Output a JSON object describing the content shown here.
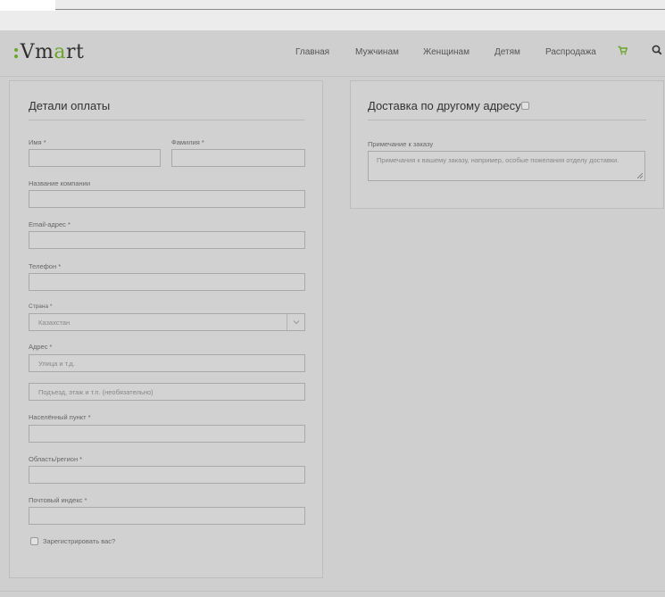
{
  "header": {
    "logo": {
      "prefix": ":",
      "part1": "Vm",
      "accent": "a",
      "part2": "rt"
    },
    "nav": [
      {
        "label": "Главная"
      },
      {
        "label": "Мужчинам"
      },
      {
        "label": "Женщинам"
      },
      {
        "label": "Детям"
      },
      {
        "label": "Распродажа"
      }
    ],
    "cart_icon": "cart-icon",
    "search_icon": "search-icon"
  },
  "billing": {
    "title": "Детали оплаты",
    "first_name_label": "Имя *",
    "last_name_label": "Фамилия *",
    "company_label": "Название компании",
    "email_label": "Email-адрес *",
    "phone_label": "Телефон *",
    "country_label": "Страна *",
    "country_value": "Казахстан",
    "address_label": "Адрес *",
    "address1_placeholder": "Улица и т.д.",
    "address2_placeholder": "Подъезд, этаж и т.п. (необязательно)",
    "city_label": "Населённый пункт *",
    "region_label": "Область/регион *",
    "postcode_label": "Почтовый индекс *",
    "register_label": "Зарегистрировать вас?"
  },
  "shipping": {
    "title": "Доставка по другому адресу?",
    "order_notes_label": "Примечание к заказу",
    "order_notes_placeholder": "Примечания к вашему заказу, например, особые пожелания отделу доставки."
  },
  "colors": {
    "accent": "#6aa52a",
    "background": "#cfcfcf"
  }
}
